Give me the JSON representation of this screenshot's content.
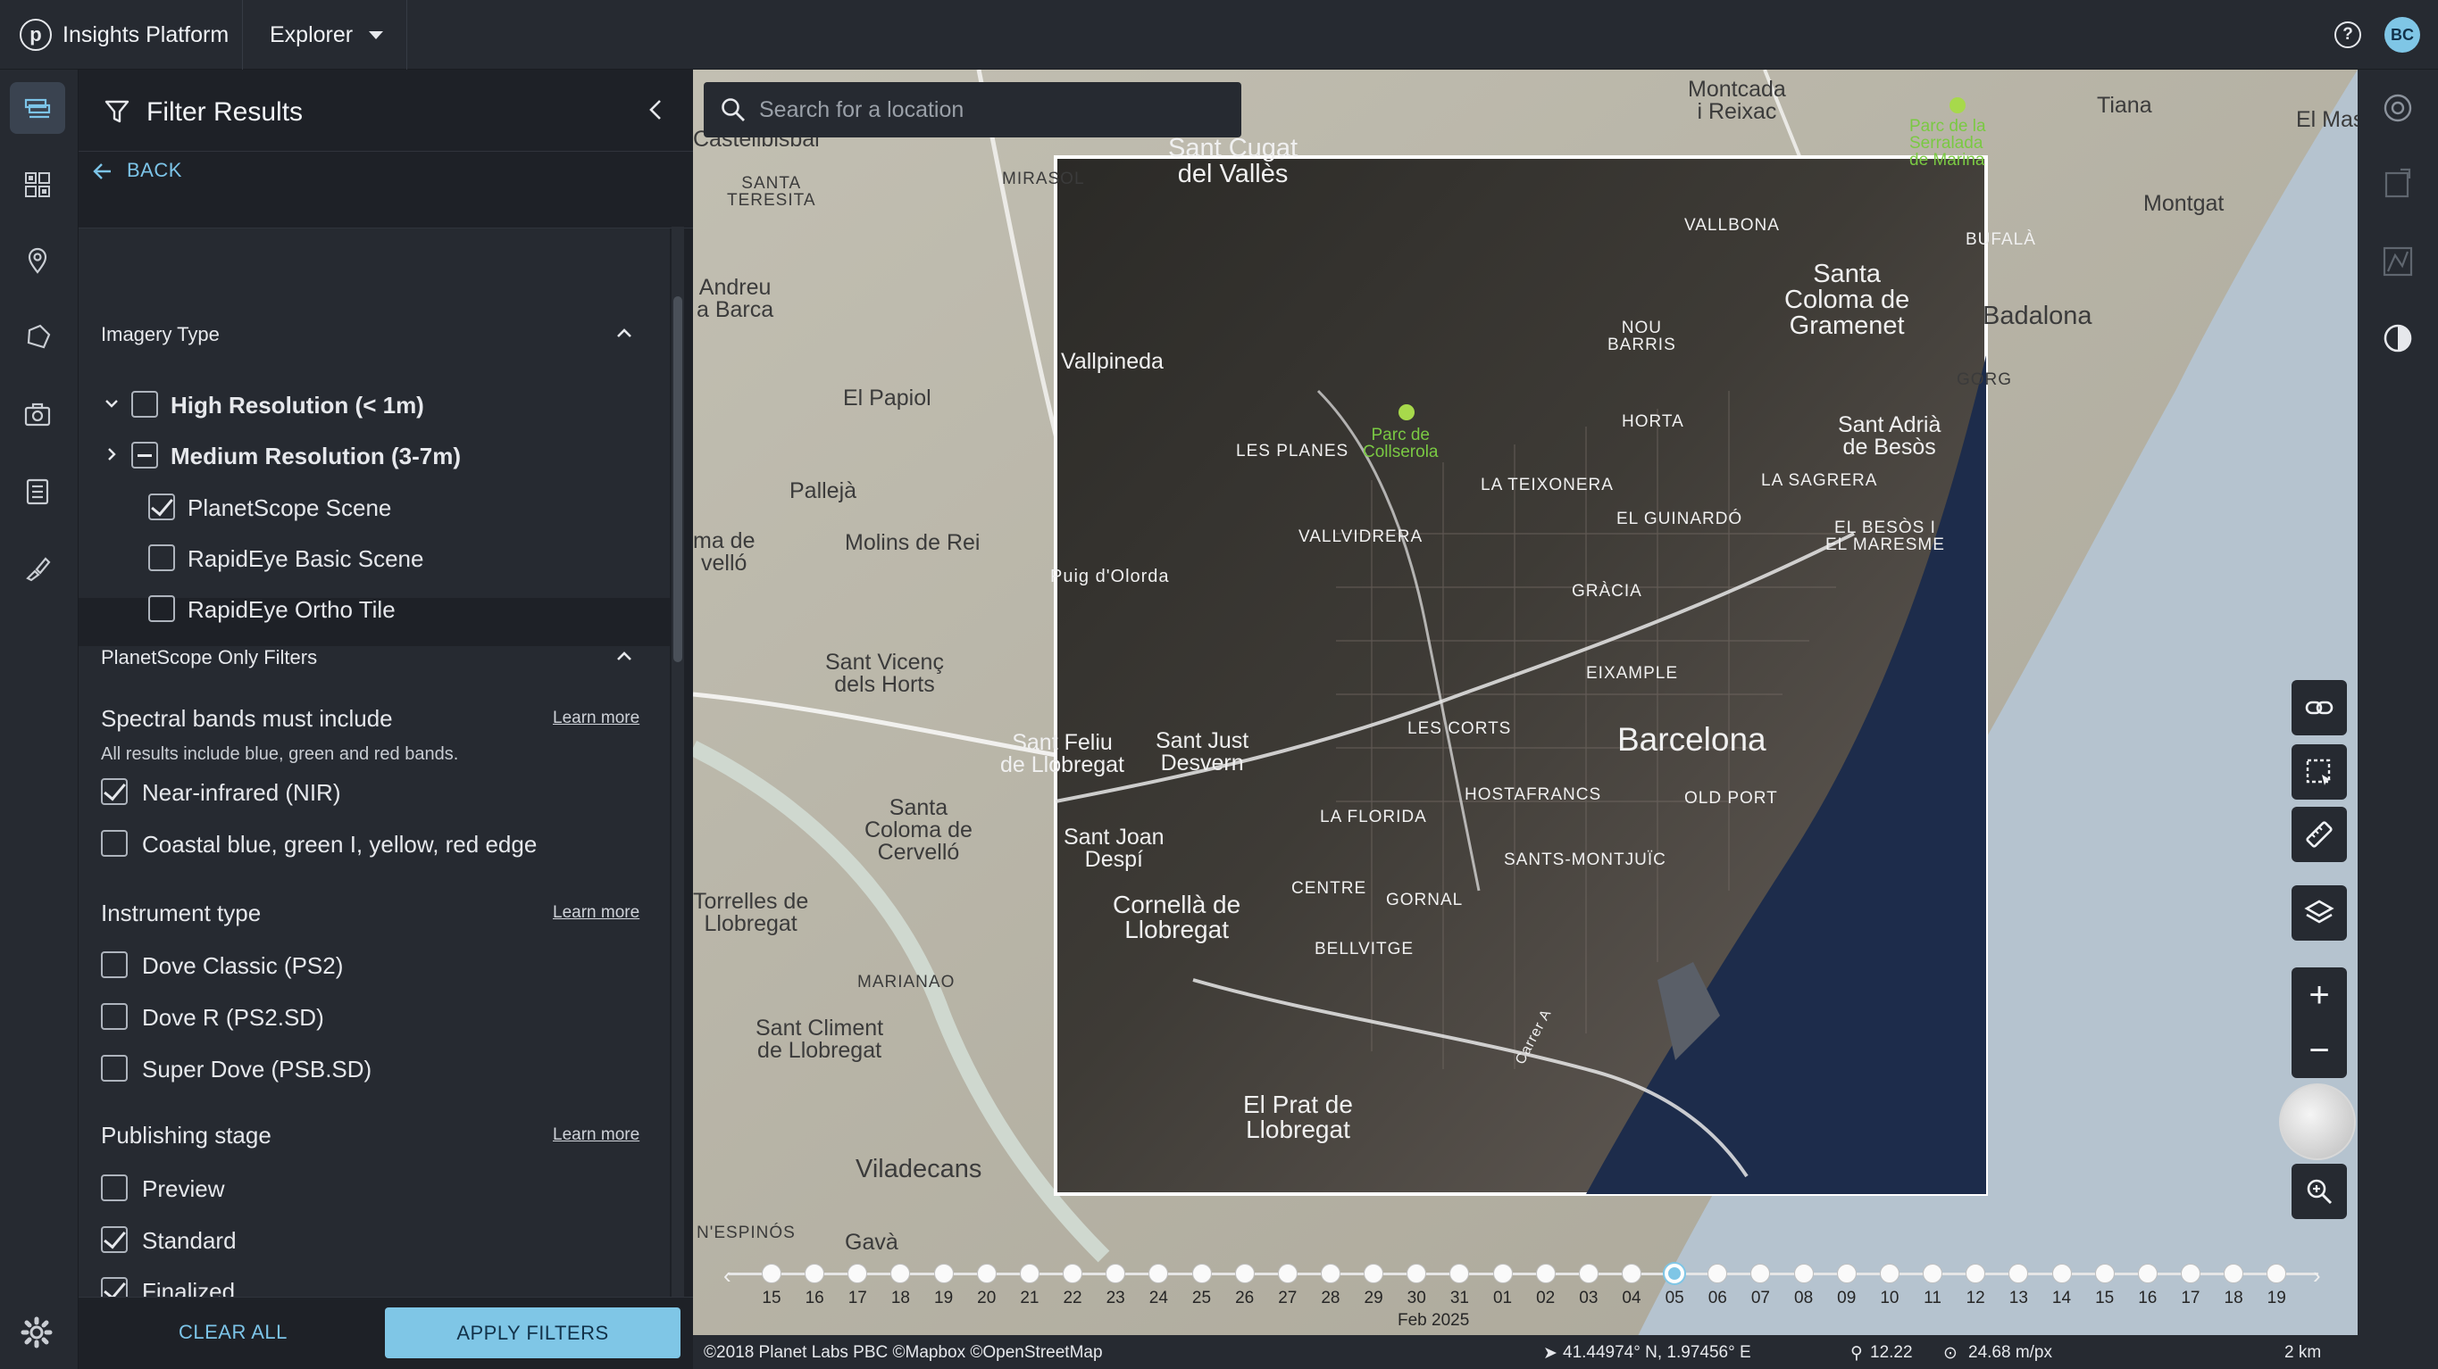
{
  "app": {
    "name": "Insights Platform",
    "logo_letter": "p",
    "view_menu": "Explorer"
  },
  "header": {
    "help": "?",
    "user_initials": "BC"
  },
  "panel": {
    "title": "Filter Results",
    "back_label": "BACK",
    "imagery_type": {
      "title": "Imagery Type",
      "items": [
        {
          "label": "High Resolution (< 1m)",
          "state": "unchecked",
          "bold": true
        },
        {
          "label": "Medium Resolution (3-7m)",
          "state": "indeterminate",
          "bold": true
        },
        {
          "label": "PlanetScope Scene",
          "state": "checked"
        },
        {
          "label": "RapidEye Basic Scene",
          "state": "unchecked"
        },
        {
          "label": "RapidEye Ortho Tile",
          "state": "unchecked"
        }
      ]
    },
    "planetscope": {
      "title": "PlanetScope Only Filters",
      "spectral": {
        "label": "Spectral bands must include",
        "learn_more": "Learn more",
        "hint": "All results include blue, green and red bands.",
        "options": [
          {
            "label": "Near-infrared (NIR)",
            "state": "checked"
          },
          {
            "label": "Coastal blue, green I, yellow, red edge",
            "state": "unchecked"
          }
        ]
      },
      "instrument": {
        "label": "Instrument type",
        "learn_more": "Learn more",
        "options": [
          {
            "label": "Dove Classic (PS2)",
            "state": "unchecked"
          },
          {
            "label": "Dove R (PS2.SD)",
            "state": "unchecked"
          },
          {
            "label": "Super Dove (PSB.SD)",
            "state": "unchecked"
          }
        ]
      },
      "publishing": {
        "label": "Publishing stage",
        "learn_more": "Learn more",
        "options": [
          {
            "label": "Preview",
            "state": "unchecked"
          },
          {
            "label": "Standard",
            "state": "checked"
          },
          {
            "label": "Finalized",
            "state": "checked"
          }
        ]
      }
    },
    "footer": {
      "clear_all": "CLEAR ALL",
      "apply": "APPLY FILTERS"
    }
  },
  "search": {
    "placeholder": "Search for a location"
  },
  "map_labels": {
    "montcada": "Montcada\ni Reixac",
    "tiana": "Tiana",
    "el_mas": "El Mas",
    "parc_serralada": "Parc de la\nSerralada\nde Marina",
    "castellbisbal": "Castellbisbal",
    "mirasol": "MIRASOL",
    "sant_cugat": "Sant Cugat\ndel Vallès",
    "santa_teresita": "SANTA\nTERESITA",
    "montgat": "Montgat",
    "vallbona": "VALLBONA",
    "bufala": "BUFALÀ",
    "santa_coloma": "Santa\nColoma de\nGramenet",
    "badalona": "Badalona",
    "andreu": "Andreu\na Barca",
    "nou_barris": "NOU\nBARRIS",
    "vallpineda": "Vallpineda",
    "gorg": "GORG",
    "el_papiol": "El Papiol",
    "parc_collserola": "Parc de\nCollserola",
    "horta": "HORTA",
    "les_planes": "LES PLANES",
    "sant_adria": "Sant Adrià\nde Besòs",
    "palleja": "Pallejà",
    "la_sagrera": "LA SAGRERA",
    "la_teixonera": "LA TEIXONERA",
    "el_besos": "EL BESÒS I\nEL MARESME",
    "el_guinardo": "EL GUINARDÓ",
    "molins": "Molins de Rei",
    "ma_de_vello": "ma de\nvelló",
    "vallvidrera": "VALLVIDRERA",
    "puig_olorda": "Puig d'Olorda",
    "gracia": "GRÀCIA",
    "sant_vicenc": "Sant Vicenç\ndels Horts",
    "eixample": "EIXAMPLE",
    "sant_feliu": "Sant Feliu\nde Llobregat",
    "sant_just": "Sant Just\nDesvern",
    "les_corts": "LES CORTS",
    "barcelona": "Barcelona",
    "santa_coloma_cervello": "Santa\nColoma de\nCervelló",
    "hostafrancs": "HOSTAFRANCS",
    "old_port": "OLD PORT",
    "la_florida": "LA FLORIDA",
    "sant_joan": "Sant Joan\nDespí",
    "sants_montjuic": "SANTS-MONTJUÏC",
    "torrelles": "Torrelles de\nLlobregat",
    "centre": "CENTRE",
    "cornella": "Cornellà de\nLlobregat",
    "gornal": "GORNAL",
    "bellvitge": "BELLVITGE",
    "marianao": "MARIANAO",
    "sant_climent": "Sant Climent\nde Llobregat",
    "el_prat": "El Prat de\nLlobregat",
    "viladecans": "Viladecans",
    "els_espinos": "N'ESPINÓS",
    "gava": "Gavà",
    "carrer_a": "Carrer A"
  },
  "timeline": {
    "days": [
      "15",
      "16",
      "17",
      "18",
      "19",
      "20",
      "21",
      "22",
      "23",
      "24",
      "25",
      "26",
      "27",
      "28",
      "29",
      "30",
      "31",
      "01",
      "02",
      "03",
      "04",
      "05",
      "06",
      "07",
      "08",
      "09",
      "10",
      "11",
      "12",
      "13",
      "14",
      "15",
      "16",
      "17",
      "18",
      "19"
    ],
    "selected_index": 21,
    "month_label": "Feb 2025"
  },
  "status_bar": {
    "attribution": "©2018 Planet Labs PBC ©Mapbox ©OpenStreetMap",
    "coords": "41.44974° N, 1.97456° E",
    "zoom": "12.22",
    "resolution": "24.68 m/px",
    "scale": "2 km"
  },
  "colors": {
    "accent": "#7fc6e6",
    "panel_bg": "#1e2127",
    "chrome_bg": "#262a31",
    "sea": "#1d2c4b"
  },
  "icons": {
    "rail": [
      "layers-list-icon",
      "grid-icon",
      "location-pin-icon",
      "polygon-icon",
      "camera-icon",
      "list-icon",
      "brush-icon"
    ],
    "map_tools": [
      "link-icon",
      "select-area-icon",
      "ruler-icon",
      "layers-icon",
      "zoom-in-icon",
      "zoom-out-icon",
      "globe-icon",
      "zoom-search-icon"
    ]
  }
}
